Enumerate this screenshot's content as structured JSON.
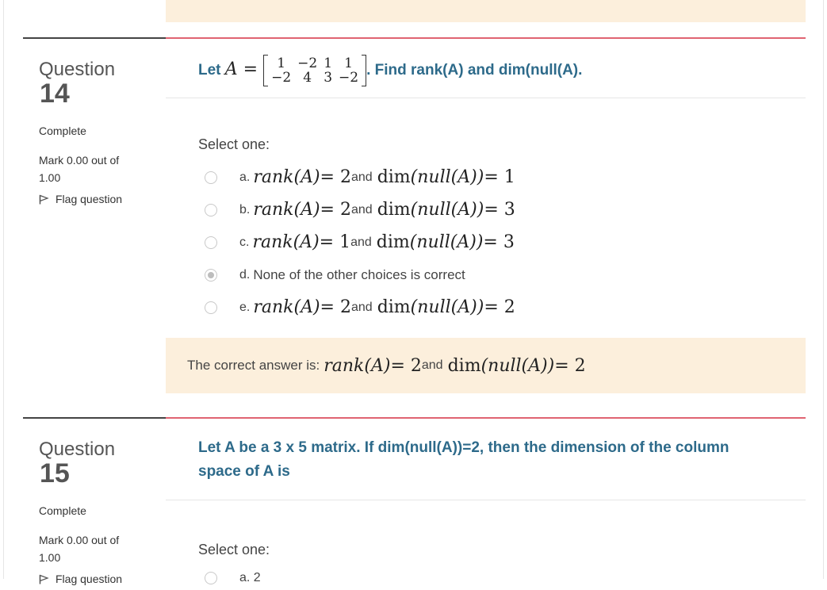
{
  "q14": {
    "label": "Question",
    "number": "14",
    "state": "Complete",
    "grade": "Mark 0.00 out of 1.00",
    "flag": "Flag question",
    "text_prefix": "Let ",
    "matrix_var": "A",
    "matrix": [
      [
        "1",
        "−2",
        "1",
        "1"
      ],
      [
        "−2",
        "4",
        "3",
        "−2"
      ]
    ],
    "text_suffix": ". Find rank(A) and dim(null(A).",
    "prompt": "Select one:",
    "options": [
      {
        "letter": "a.",
        "rank": "rank",
        "A": "(A)",
        "eq1": "= 2",
        "and": "and",
        "dim": "dim",
        "null": "(null(A))",
        "eq2": "= 1",
        "selected": false
      },
      {
        "letter": "b.",
        "rank": "rank",
        "A": "(A)",
        "eq1": "= 2",
        "and": "and",
        "dim": "dim",
        "null": "(null(A))",
        "eq2": "= 3",
        "selected": false
      },
      {
        "letter": "c.",
        "rank": "rank",
        "A": "(A)",
        "eq1": "= 1",
        "and": "and",
        "dim": "dim",
        "null": "(null(A))",
        "eq2": "= 3",
        "selected": false
      },
      {
        "letter": "d.",
        "text": "None of the other choices is correct",
        "selected": true
      },
      {
        "letter": "e.",
        "rank": "rank",
        "A": "(A)",
        "eq1": "= 2",
        "and": "and",
        "dim": "dim",
        "null": "(null(A))",
        "eq2": "= 2",
        "selected": false
      }
    ],
    "feedback_prefix": "The correct answer is: ",
    "feedback": {
      "rank": "rank",
      "A": "(A)",
      "eq1": "= 2",
      "and": "and",
      "dim": "dim",
      "null": "(null(A))",
      "eq2": "= 2"
    }
  },
  "q15": {
    "label": "Question",
    "number": "15",
    "state": "Complete",
    "grade": "Mark 0.00 out of 1.00",
    "flag": "Flag question",
    "text": "Let A be a 3 x 5 matrix. If dim(null(A))=2, then the dimension of the column space of A is",
    "prompt": "Select one:",
    "first_option": "a. 2"
  },
  "colors": {
    "accent": "#e06472",
    "question_text": "#2d6a8a",
    "feedback_bg": "#fcefdc"
  }
}
